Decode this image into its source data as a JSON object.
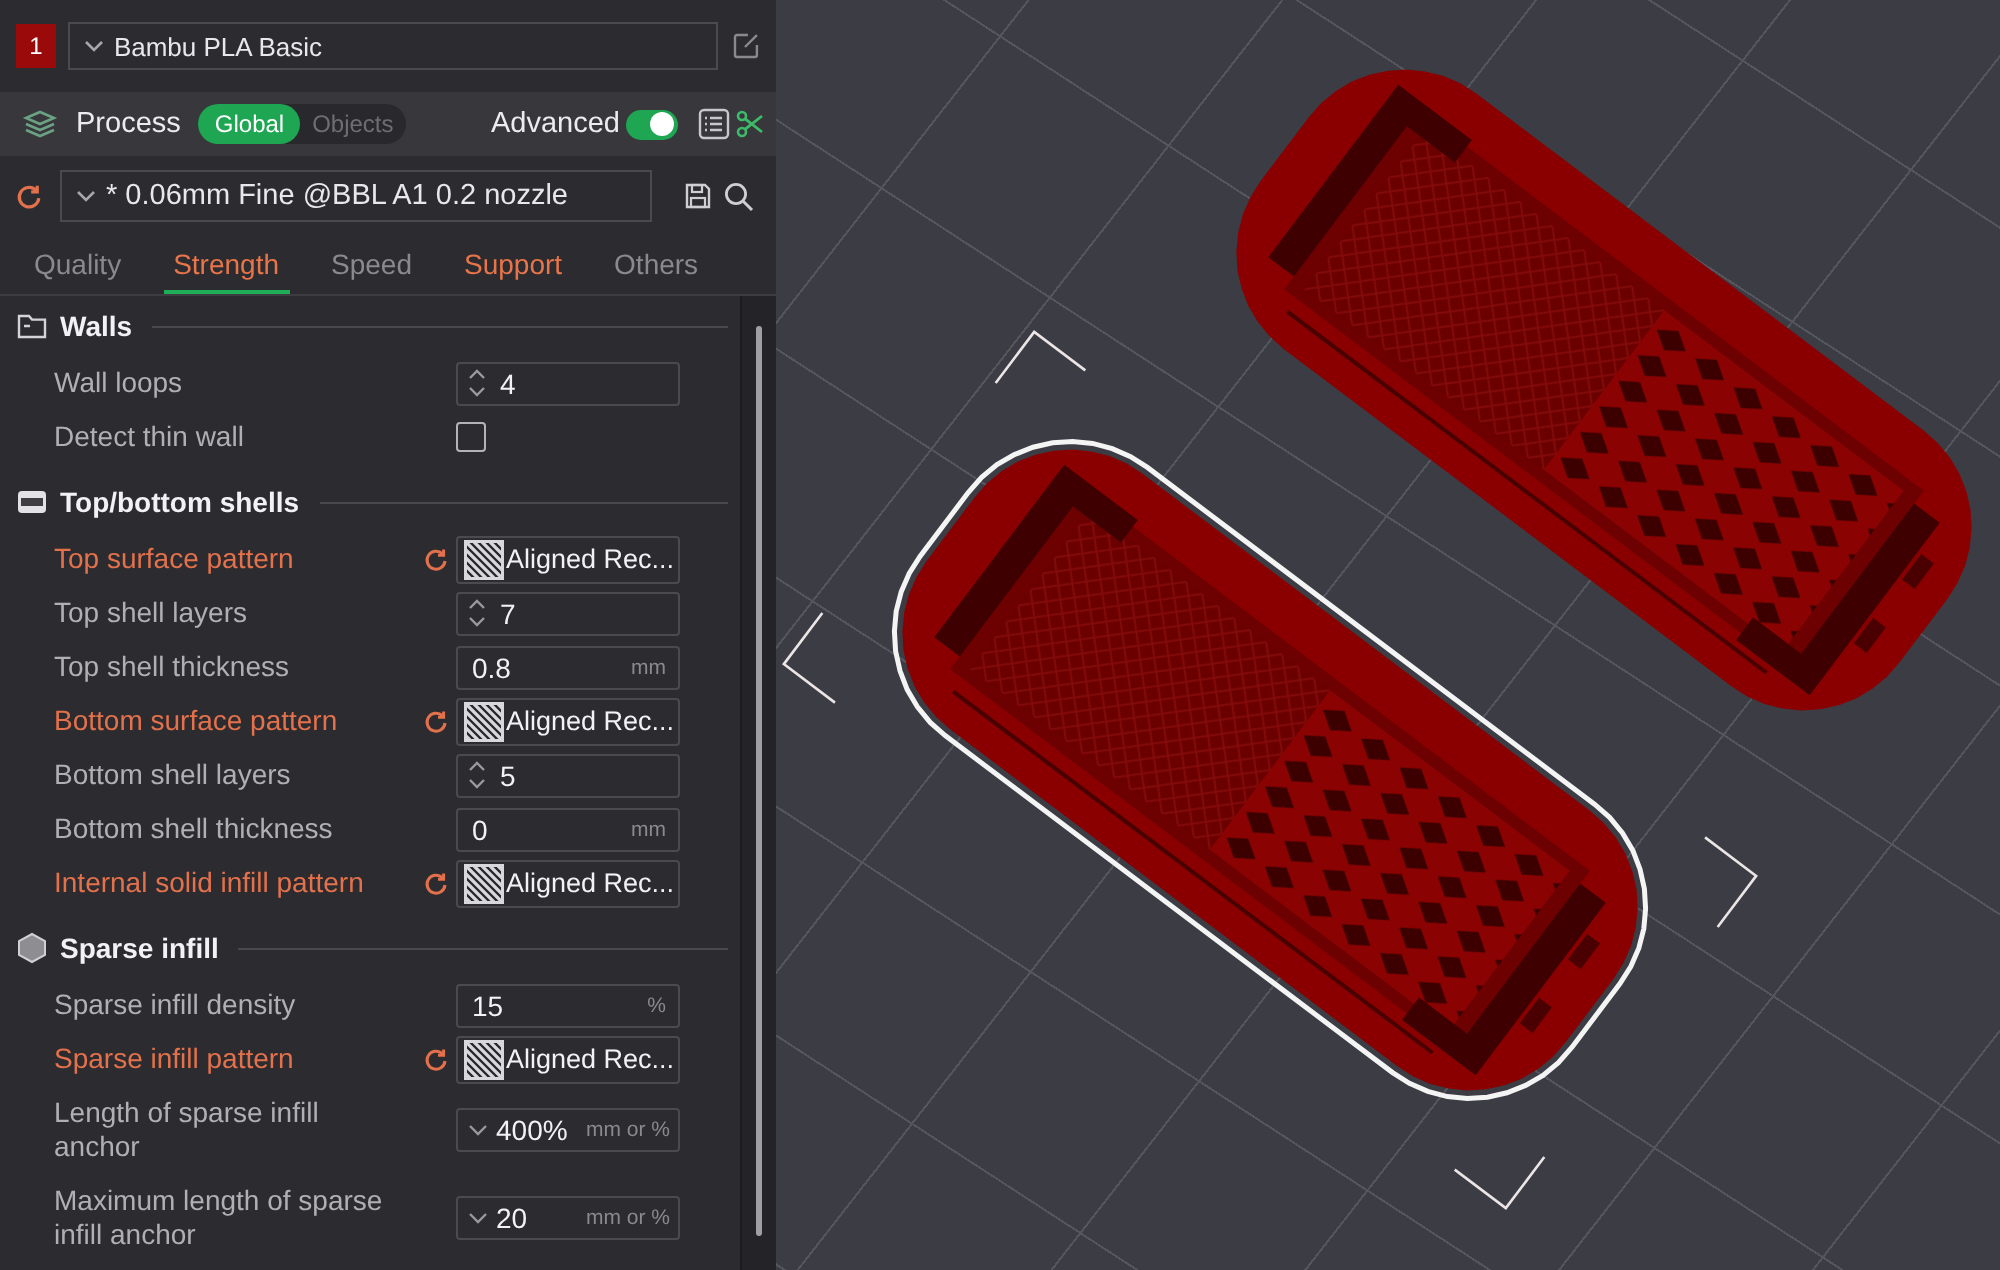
{
  "filament": {
    "index": "1",
    "name": "Bambu PLA Basic"
  },
  "process": {
    "title": "Process",
    "scopes": [
      {
        "label": "Global",
        "selected": true
      },
      {
        "label": "Objects",
        "selected": false
      }
    ],
    "advanced": {
      "label": "Advanced",
      "on": true
    }
  },
  "preset": {
    "name": "* 0.06mm Fine @BBL A1 0.2 nozzle",
    "modified": true
  },
  "tabs": [
    {
      "label": "Quality",
      "selected": false,
      "modified": false
    },
    {
      "label": "Strength",
      "selected": true,
      "modified": true
    },
    {
      "label": "Speed",
      "selected": false,
      "modified": false
    },
    {
      "label": "Support",
      "selected": false,
      "modified": true
    },
    {
      "label": "Others",
      "selected": false,
      "modified": false
    }
  ],
  "sections": [
    {
      "title": "Walls",
      "settings": [
        {
          "label": "Wall loops",
          "kind": "spin",
          "value": "4",
          "modified": false
        },
        {
          "label": "Detect thin wall",
          "kind": "checkbox",
          "checked": false,
          "modified": false
        }
      ]
    },
    {
      "title": "Top/bottom shells",
      "settings": [
        {
          "label": "Top surface pattern",
          "kind": "pattern",
          "value": "Aligned Rec...",
          "modified": true
        },
        {
          "label": "Top shell layers",
          "kind": "spin",
          "value": "7",
          "modified": false
        },
        {
          "label": "Top shell thickness",
          "kind": "unit",
          "value": "0.8",
          "unit": "mm",
          "modified": false
        },
        {
          "label": "Bottom surface pattern",
          "kind": "pattern",
          "value": "Aligned Rec...",
          "modified": true
        },
        {
          "label": "Bottom shell layers",
          "kind": "spin",
          "value": "5",
          "modified": false
        },
        {
          "label": "Bottom shell thickness",
          "kind": "unit",
          "value": "0",
          "unit": "mm",
          "modified": false
        },
        {
          "label": "Internal solid infill pattern",
          "kind": "pattern",
          "value": "Aligned Rec...",
          "modified": true
        }
      ]
    },
    {
      "title": "Sparse infill",
      "settings": [
        {
          "label": "Sparse infill density",
          "kind": "unit",
          "value": "15",
          "unit": "%",
          "modified": false
        },
        {
          "label": "Sparse infill pattern",
          "kind": "pattern",
          "value": "Aligned Rec...",
          "modified": true
        },
        {
          "label": "Length of sparse infill anchor",
          "kind": "combo",
          "value": "400%",
          "unit": "mm or %",
          "modified": false
        },
        {
          "label": "Maximum length of sparse infill anchor",
          "kind": "combo",
          "value": "20",
          "unit": "mm or %",
          "modified": false
        }
      ]
    }
  ],
  "viewport": {
    "objects": [
      {
        "selected": false
      },
      {
        "selected": true
      }
    ]
  }
}
